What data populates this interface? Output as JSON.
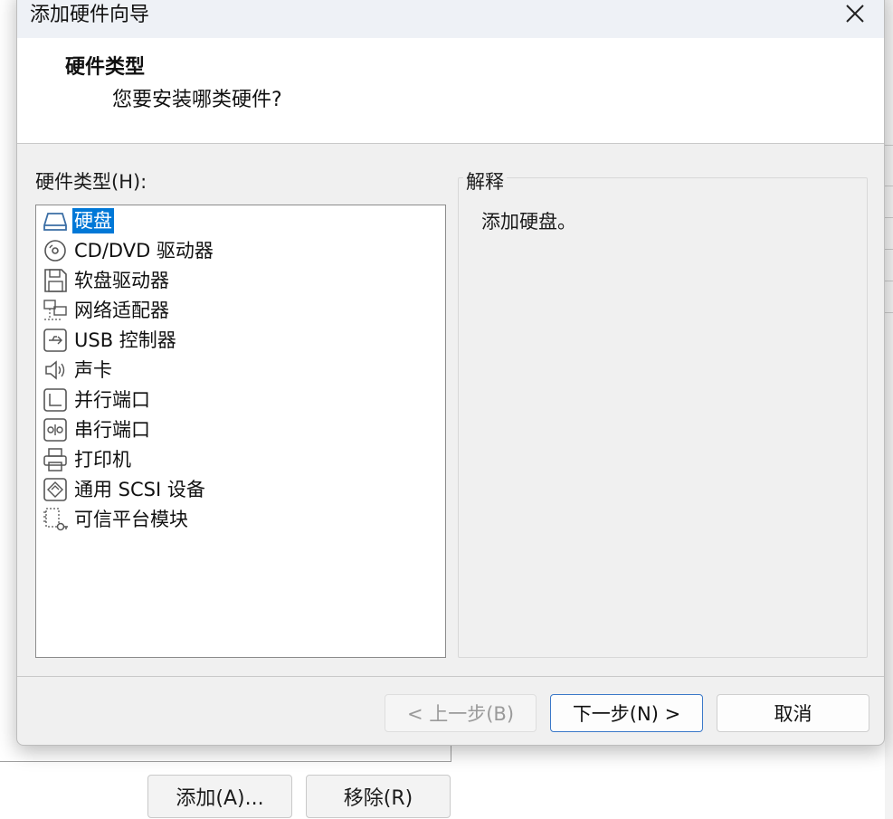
{
  "dialog": {
    "title": "添加硬件向导",
    "header_title": "硬件类型",
    "header_subtitle": "您要安装哪类硬件?",
    "list_label": "硬件类型(H):",
    "hardware_items": [
      {
        "label": "硬盘",
        "icon": "hard-disk-icon",
        "selected": true
      },
      {
        "label": "CD/DVD 驱动器",
        "icon": "cd-dvd-icon"
      },
      {
        "label": "软盘驱动器",
        "icon": "floppy-icon"
      },
      {
        "label": "网络适配器",
        "icon": "network-adapter-icon"
      },
      {
        "label": "USB 控制器",
        "icon": "usb-icon"
      },
      {
        "label": "声卡",
        "icon": "speaker-icon"
      },
      {
        "label": "并行端口",
        "icon": "parallel-port-icon"
      },
      {
        "label": "串行端口",
        "icon": "serial-port-icon"
      },
      {
        "label": "打印机",
        "icon": "printer-icon"
      },
      {
        "label": "通用 SCSI 设备",
        "icon": "scsi-icon"
      },
      {
        "label": "可信平台模块",
        "icon": "tpm-icon"
      }
    ],
    "explanation_label": "解释",
    "explanation_text": "添加硬盘。",
    "buttons": {
      "back": "< 上一步(B)",
      "next": "下一步(N) >",
      "cancel": "取消"
    }
  },
  "background": {
    "add_button": "添加(A)...",
    "remove_button": "移除(R)"
  },
  "colors": {
    "selection": "#0078d7",
    "dialog_bg": "#f0f0f0",
    "primary_border": "#3a78c8"
  }
}
